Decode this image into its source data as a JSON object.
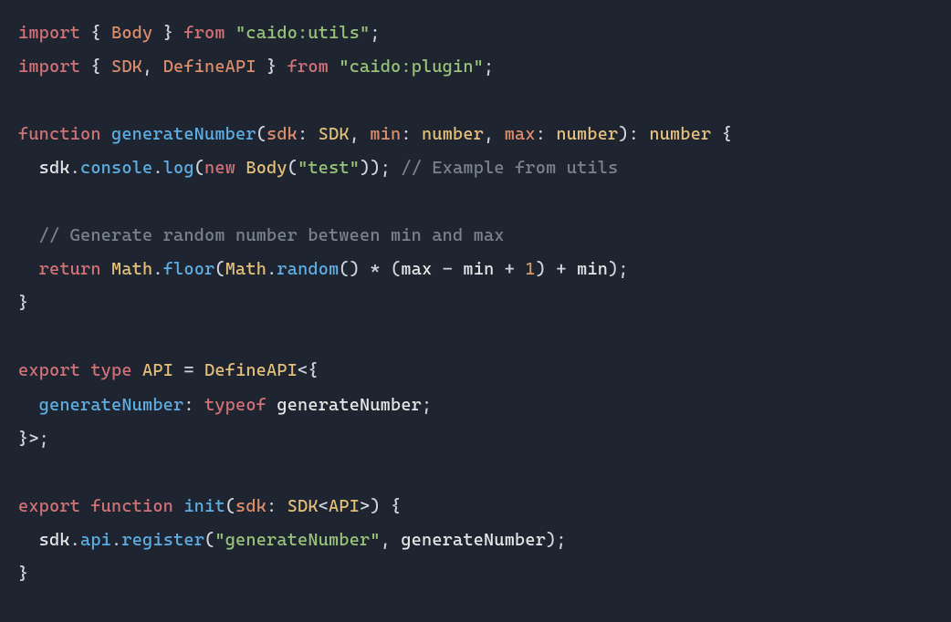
{
  "code": {
    "lines": [
      [
        {
          "t": "import ",
          "c": "tk-keyword"
        },
        {
          "t": "{ ",
          "c": "tk-punct"
        },
        {
          "t": "Body",
          "c": "tk-prop"
        },
        {
          "t": " } ",
          "c": "tk-punct"
        },
        {
          "t": "from ",
          "c": "tk-keyword"
        },
        {
          "t": "\"caido:utils\"",
          "c": "tk-string"
        },
        {
          "t": ";",
          "c": "tk-punct"
        }
      ],
      [
        {
          "t": "import ",
          "c": "tk-keyword"
        },
        {
          "t": "{ ",
          "c": "tk-punct"
        },
        {
          "t": "SDK",
          "c": "tk-prop"
        },
        {
          "t": ", ",
          "c": "tk-punct"
        },
        {
          "t": "DefineAPI",
          "c": "tk-prop"
        },
        {
          "t": " } ",
          "c": "tk-punct"
        },
        {
          "t": "from ",
          "c": "tk-keyword"
        },
        {
          "t": "\"caido:plugin\"",
          "c": "tk-string"
        },
        {
          "t": ";",
          "c": "tk-punct"
        }
      ],
      [],
      [
        {
          "t": "function ",
          "c": "tk-keyword"
        },
        {
          "t": "generateNumber",
          "c": "tk-func"
        },
        {
          "t": "(",
          "c": "tk-punct"
        },
        {
          "t": "sdk",
          "c": "tk-prop"
        },
        {
          "t": ": ",
          "c": "tk-punct"
        },
        {
          "t": "SDK",
          "c": "tk-type"
        },
        {
          "t": ", ",
          "c": "tk-punct"
        },
        {
          "t": "min",
          "c": "tk-prop"
        },
        {
          "t": ": ",
          "c": "tk-punct"
        },
        {
          "t": "number",
          "c": "tk-type"
        },
        {
          "t": ", ",
          "c": "tk-punct"
        },
        {
          "t": "max",
          "c": "tk-prop"
        },
        {
          "t": ": ",
          "c": "tk-punct"
        },
        {
          "t": "number",
          "c": "tk-type"
        },
        {
          "t": "): ",
          "c": "tk-punct"
        },
        {
          "t": "number",
          "c": "tk-type"
        },
        {
          "t": " {",
          "c": "tk-punct"
        }
      ],
      [
        {
          "t": "  ",
          "c": ""
        },
        {
          "t": "sdk",
          "c": "tk-var"
        },
        {
          "t": ".",
          "c": "tk-punct"
        },
        {
          "t": "console",
          "c": "tk-func"
        },
        {
          "t": ".",
          "c": "tk-punct"
        },
        {
          "t": "log",
          "c": "tk-func"
        },
        {
          "t": "(",
          "c": "tk-punct"
        },
        {
          "t": "new ",
          "c": "tk-keyword"
        },
        {
          "t": "Body",
          "c": "tk-type"
        },
        {
          "t": "(",
          "c": "tk-punct"
        },
        {
          "t": "\"test\"",
          "c": "tk-string"
        },
        {
          "t": ")); ",
          "c": "tk-punct"
        },
        {
          "t": "// Example from utils",
          "c": "tk-comment"
        }
      ],
      [],
      [
        {
          "t": "  ",
          "c": ""
        },
        {
          "t": "// Generate random number between min and max",
          "c": "tk-comment"
        }
      ],
      [
        {
          "t": "  ",
          "c": ""
        },
        {
          "t": "return ",
          "c": "tk-keyword"
        },
        {
          "t": "Math",
          "c": "tk-type"
        },
        {
          "t": ".",
          "c": "tk-punct"
        },
        {
          "t": "floor",
          "c": "tk-func"
        },
        {
          "t": "(",
          "c": "tk-punct"
        },
        {
          "t": "Math",
          "c": "tk-type"
        },
        {
          "t": ".",
          "c": "tk-punct"
        },
        {
          "t": "random",
          "c": "tk-func"
        },
        {
          "t": "() * (",
          "c": "tk-punct"
        },
        {
          "t": "max",
          "c": "tk-var"
        },
        {
          "t": " - ",
          "c": "tk-punct"
        },
        {
          "t": "min",
          "c": "tk-var"
        },
        {
          "t": " + ",
          "c": "tk-punct"
        },
        {
          "t": "1",
          "c": "tk-number"
        },
        {
          "t": ") + ",
          "c": "tk-punct"
        },
        {
          "t": "min",
          "c": "tk-var"
        },
        {
          "t": ");",
          "c": "tk-punct"
        }
      ],
      [
        {
          "t": "}",
          "c": "tk-punct"
        }
      ],
      [],
      [
        {
          "t": "export ",
          "c": "tk-keyword"
        },
        {
          "t": "type ",
          "c": "tk-keyword"
        },
        {
          "t": "API",
          "c": "tk-type"
        },
        {
          "t": " = ",
          "c": "tk-punct"
        },
        {
          "t": "DefineAPI",
          "c": "tk-type"
        },
        {
          "t": "<{",
          "c": "tk-punct"
        }
      ],
      [
        {
          "t": "  ",
          "c": ""
        },
        {
          "t": "generateNumber",
          "c": "tk-func"
        },
        {
          "t": ": ",
          "c": "tk-punct"
        },
        {
          "t": "typeof ",
          "c": "tk-keyword"
        },
        {
          "t": "generateNumber",
          "c": "tk-var"
        },
        {
          "t": ";",
          "c": "tk-punct"
        }
      ],
      [
        {
          "t": "}>;",
          "c": "tk-punct"
        }
      ],
      [],
      [
        {
          "t": "export ",
          "c": "tk-keyword"
        },
        {
          "t": "function ",
          "c": "tk-keyword"
        },
        {
          "t": "init",
          "c": "tk-func"
        },
        {
          "t": "(",
          "c": "tk-punct"
        },
        {
          "t": "sdk",
          "c": "tk-prop"
        },
        {
          "t": ": ",
          "c": "tk-punct"
        },
        {
          "t": "SDK",
          "c": "tk-type"
        },
        {
          "t": "<",
          "c": "tk-punct"
        },
        {
          "t": "API",
          "c": "tk-type"
        },
        {
          "t": ">) {",
          "c": "tk-punct"
        }
      ],
      [
        {
          "t": "  ",
          "c": ""
        },
        {
          "t": "sdk",
          "c": "tk-var"
        },
        {
          "t": ".",
          "c": "tk-punct"
        },
        {
          "t": "api",
          "c": "tk-func"
        },
        {
          "t": ".",
          "c": "tk-punct"
        },
        {
          "t": "register",
          "c": "tk-func"
        },
        {
          "t": "(",
          "c": "tk-punct"
        },
        {
          "t": "\"generateNumber\"",
          "c": "tk-string"
        },
        {
          "t": ", ",
          "c": "tk-punct"
        },
        {
          "t": "generateNumber",
          "c": "tk-var"
        },
        {
          "t": ");",
          "c": "tk-punct"
        }
      ],
      [
        {
          "t": "}",
          "c": "tk-punct"
        }
      ]
    ]
  }
}
